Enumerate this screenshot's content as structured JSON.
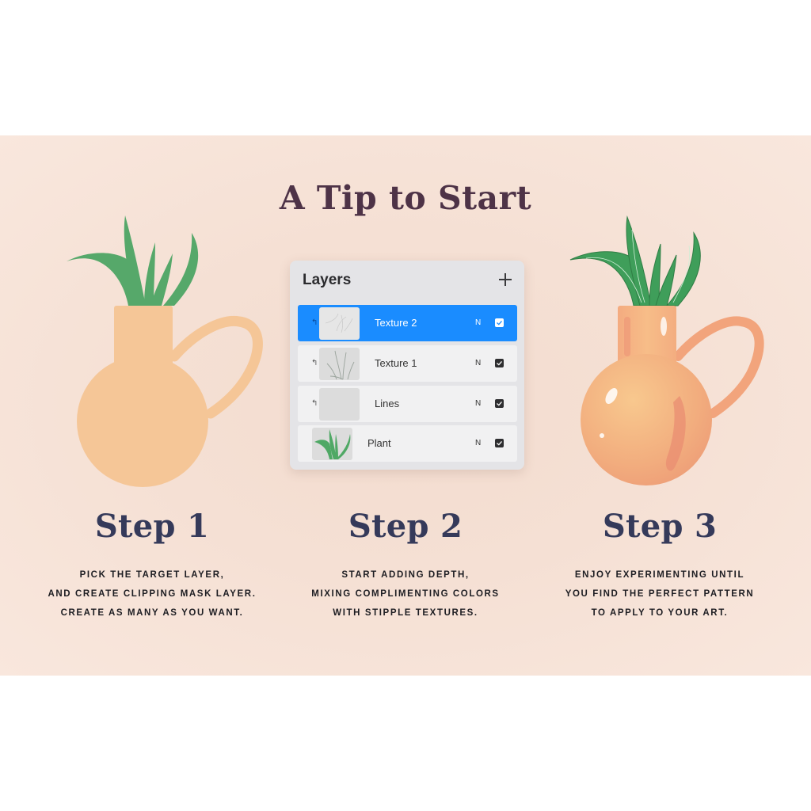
{
  "title": "A Tip to Start",
  "colors": {
    "title": "#4e3347",
    "step_heading": "#353a5a",
    "band_background": "#f5e0d4",
    "vase_flat": "#f5c697",
    "plant_green": "#56a86a",
    "selected_layer": "#1a8cff"
  },
  "layers_panel": {
    "title": "Layers",
    "add_icon": "plus-icon",
    "layers": [
      {
        "name": "Texture 2",
        "mode": "N",
        "visible": true,
        "selected": true,
        "clipping_mask": true,
        "thumbnail": "sketch-lines-thumbnail"
      },
      {
        "name": "Texture 1",
        "mode": "N",
        "visible": true,
        "selected": false,
        "clipping_mask": true,
        "thumbnail": "grass-stroke-thumbnail"
      },
      {
        "name": "Lines",
        "mode": "N",
        "visible": true,
        "selected": false,
        "clipping_mask": true,
        "thumbnail": "blank-thumbnail"
      },
      {
        "name": "Plant",
        "mode": "N",
        "visible": true,
        "selected": false,
        "clipping_mask": false,
        "thumbnail": "green-plant-thumbnail"
      }
    ]
  },
  "steps": [
    {
      "heading": "Step 1",
      "lines": [
        "PICK THE TARGET LAYER,",
        "AND CREATE CLIPPING MASK LAYER.",
        "CREATE AS MANY AS YOU WANT."
      ],
      "illustration": "flat-vase-with-plant"
    },
    {
      "heading": "Step 2",
      "lines": [
        "START ADDING DEPTH,",
        "MIXING COMPLIMENTING COLORS",
        "WITH STIPPLE TEXTURES."
      ],
      "illustration": "layers-panel"
    },
    {
      "heading": "Step 3",
      "lines": [
        "ENJOY EXPERIMENTING UNTIL",
        "YOU FIND THE PERFECT PATTERN",
        "TO APPLY TO YOUR ART."
      ],
      "illustration": "textured-vase-with-plant"
    }
  ]
}
